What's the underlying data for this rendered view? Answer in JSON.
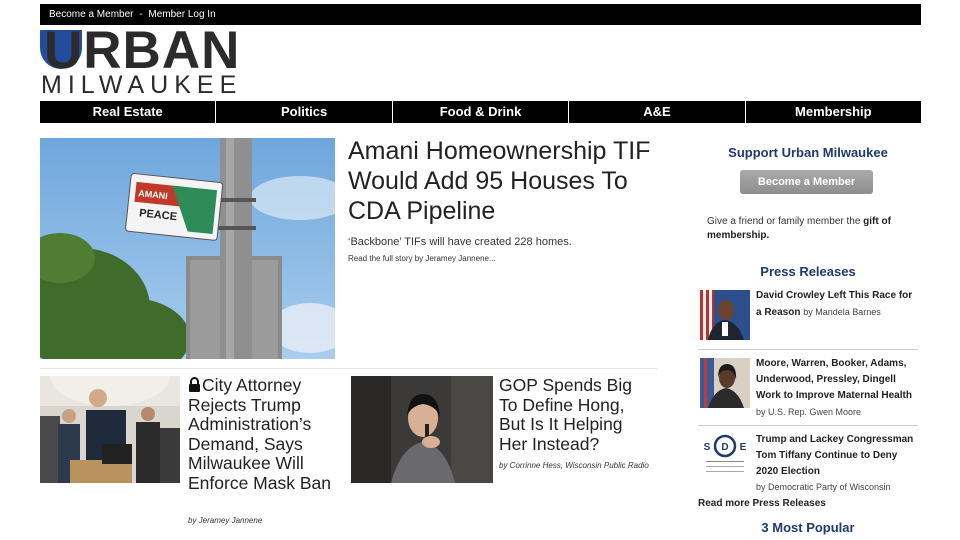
{
  "topbar": {
    "become_member": "Become a Member",
    "separator": "-",
    "login": "Member Log In"
  },
  "logo": {
    "word1": "URBAN",
    "word2": "MILWAUKEE"
  },
  "nav": {
    "items": [
      "Real Estate",
      "Politics",
      "Food & Drink",
      "A&E",
      "Membership"
    ]
  },
  "hero": {
    "title": "Amani Homeownership TIF Would Add 95 Houses To CDA Pipeline",
    "subtitle": "‘Backbone’ TIFs will have created 228 homes.",
    "read_more": "Read the full story by Jeramey Jannene...",
    "sign_text": "PEACE",
    "sign_top": "AMANI"
  },
  "articles": [
    {
      "title": "City Attorney Rejects Trump Administration’s Demand, Says Milwaukee Will Enforce Mask Ban",
      "byline": "by Jeramey Jannene"
    },
    {
      "title": "GOP Spends Big To Define Hong, But Is It Helping Her Instead?",
      "byline": "by Corrinne Hess, Wisconsin Public Radio"
    }
  ],
  "sidebar": {
    "support_title": "Support Urban Milwaukee",
    "member_button": "Become a Member",
    "gift_pre": "Give a friend or family member the ",
    "gift_bold": "gift of membership.",
    "press_title": "Press Releases",
    "press": [
      {
        "headline": "David Crowley Left This Race for a Reason",
        "by": "by Mandela Barnes"
      },
      {
        "headline": "Moore, Warren, Booker, Adams, Underwood, Pressley, Dingell Work to Improve Maternal Health",
        "by": "by U.S. Rep. Gwen Moore"
      },
      {
        "headline": "Trump and Lackey Congressman Tom Tiffany Continue to Deny 2020 Election",
        "by": "by Democratic Party of Wisconsin"
      }
    ],
    "sde_logo": "SDE",
    "read_more": "Read more Press Releases",
    "popular_title": "3 Most Popular"
  },
  "colors": {
    "accent_blue": "#1f3a6d",
    "logo_blue": "#244c9c",
    "nav_bg": "#000000"
  }
}
